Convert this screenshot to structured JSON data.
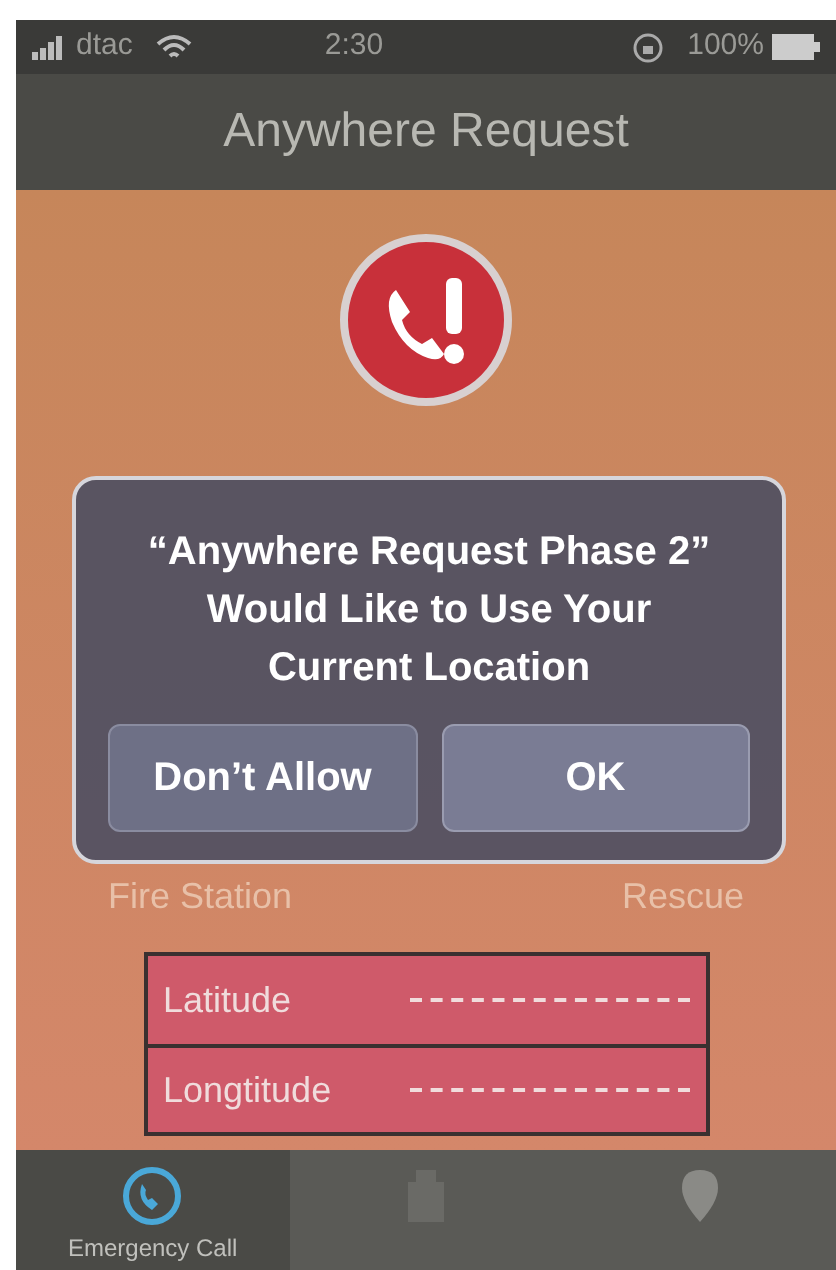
{
  "status_bar": {
    "carrier": "dtac",
    "time": "2:30",
    "battery": "100%"
  },
  "nav_bar": {
    "title": "Anywhere Request"
  },
  "labels": [
    "Fire Station",
    "Rescue"
  ],
  "fields": [
    {
      "label": "Latitude"
    },
    {
      "label": "Longtitude"
    }
  ],
  "alert": {
    "message": "“Anywhere Request Phase 2” Would Like to Use Your Current Location",
    "buttons": [
      "Don’t Allow",
      "OK"
    ]
  },
  "tabs": [
    {
      "label": "Emergency Call",
      "kind": "phone",
      "selected": true
    },
    {
      "kind": "building",
      "selected": false
    },
    {
      "kind": "pin",
      "selected": false
    }
  ]
}
